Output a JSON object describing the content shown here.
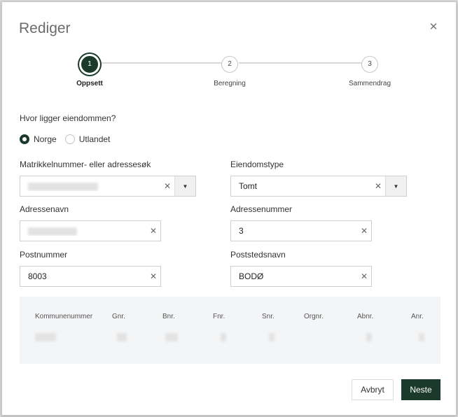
{
  "dialog": {
    "title": "Rediger"
  },
  "stepper": {
    "steps": [
      {
        "number": "1",
        "label": "Oppsett"
      },
      {
        "number": "2",
        "label": "Beregning"
      },
      {
        "number": "3",
        "label": "Sammendrag"
      }
    ]
  },
  "location": {
    "question": "Hvor ligger eiendommen?",
    "options": [
      "Norge",
      "Utlandet"
    ],
    "selected": "Norge"
  },
  "fields": {
    "search": {
      "label": "Matrikkelnummer- eller adressesøk"
    },
    "property_type": {
      "label": "Eiendomstype",
      "value": "Tomt"
    },
    "street_name": {
      "label": "Adressenavn"
    },
    "street_number": {
      "label": "Adressenummer",
      "value": "3"
    },
    "postal_code": {
      "label": "Postnummer",
      "value": "8003"
    },
    "postal_place": {
      "label": "Poststedsnavn",
      "value": "BODØ"
    }
  },
  "table": {
    "headers": [
      "Kommunenummer",
      "Gnr.",
      "Bnr.",
      "Fnr.",
      "Snr.",
      "Orgnr.",
      "Abnr.",
      "Anr."
    ]
  },
  "buttons": {
    "cancel": "Avbryt",
    "next": "Neste"
  },
  "icons": {
    "close": "close-icon",
    "clear": "clear-icon",
    "dropdown": "caret-down-icon"
  },
  "colors": {
    "primary": "#1c3a2b",
    "border": "#cfcfcf",
    "panel": "#f4f5f7"
  }
}
